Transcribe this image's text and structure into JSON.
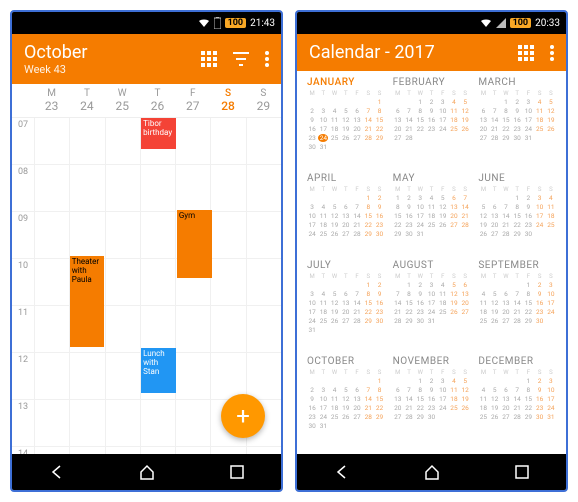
{
  "left": {
    "status": {
      "battery": "100",
      "time": "21:43"
    },
    "header": {
      "title": "October",
      "subtitle": "Week 43"
    },
    "days": [
      {
        "name": "M",
        "num": "23"
      },
      {
        "name": "T",
        "num": "24"
      },
      {
        "name": "W",
        "num": "25"
      },
      {
        "name": "T",
        "num": "26"
      },
      {
        "name": "F",
        "num": "27"
      },
      {
        "name": "S",
        "num": "28",
        "today": true
      },
      {
        "name": "S",
        "num": "29"
      }
    ],
    "hours": [
      "07",
      "08",
      "09",
      "10",
      "11",
      "12",
      "13",
      "14"
    ],
    "events": [
      {
        "title": "Tibor birthday",
        "color": "#f44336",
        "day": 3,
        "start": 7,
        "dur": 0.7
      },
      {
        "title": "Gym",
        "color": "#f57c00",
        "day": 4,
        "start": 9,
        "dur": 1.5
      },
      {
        "title": "Theater with Paula",
        "color": "#f57c00",
        "day": 1,
        "start": 10,
        "dur": 2
      },
      {
        "title": "Lunch with Stan",
        "color": "#2196f3",
        "day": 3,
        "start": 12,
        "dur": 1
      }
    ],
    "fab": "+"
  },
  "right": {
    "status": {
      "battery": "100",
      "time": "20:33"
    },
    "header": {
      "title": "Calendar - 2017"
    },
    "months": [
      {
        "name": "JANUARY",
        "current": true,
        "start": 6,
        "days": 31,
        "today": 24
      },
      {
        "name": "FEBRUARY",
        "start": 2,
        "days": 28
      },
      {
        "name": "MARCH",
        "start": 2,
        "days": 31
      },
      {
        "name": "APRIL",
        "start": 5,
        "days": 30
      },
      {
        "name": "MAY",
        "start": 0,
        "days": 31
      },
      {
        "name": "JUNE",
        "start": 3,
        "days": 30
      },
      {
        "name": "JULY",
        "start": 5,
        "days": 31
      },
      {
        "name": "AUGUST",
        "start": 1,
        "days": 31
      },
      {
        "name": "SEPTEMBER",
        "start": 4,
        "days": 30
      },
      {
        "name": "OCTOBER",
        "start": 6,
        "days": 31
      },
      {
        "name": "NOVEMBER",
        "start": 2,
        "days": 30
      },
      {
        "name": "DECEMBER",
        "start": 4,
        "days": 31
      }
    ],
    "dayHeaders": [
      "M",
      "T",
      "W",
      "T",
      "F",
      "S",
      "S"
    ]
  }
}
